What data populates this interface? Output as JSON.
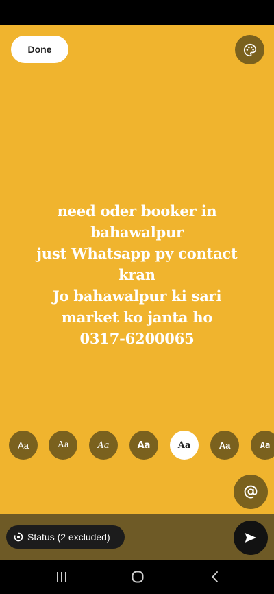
{
  "toolbar": {
    "done_label": "Done",
    "palette_icon": "palette-icon"
  },
  "status": {
    "text": "need oder booker in\nbahawalpur\njust Whatsapp py contact\nkran\nJo bahawalpur ki sari\nmarket ko janta ho\n0317-6200065",
    "background_color": "#F0B42E",
    "text_color": "#FFFFFF"
  },
  "font_options": {
    "items": [
      {
        "label": "Aa",
        "selected": false
      },
      {
        "label": "Aa",
        "selected": false
      },
      {
        "label": "Aa",
        "selected": false
      },
      {
        "label": "Aa",
        "selected": false
      },
      {
        "label": "Aa",
        "selected": true
      },
      {
        "label": "Aa",
        "selected": false
      },
      {
        "label": "Aa",
        "selected": false
      }
    ]
  },
  "mention": {
    "icon": "at-sign-icon"
  },
  "audience": {
    "label": "Status (2 excluded)",
    "icon": "status-ring-icon"
  },
  "send": {
    "icon": "send-icon"
  },
  "navigation": {
    "recents_icon": "recents-icon",
    "home_icon": "home-icon",
    "back_icon": "back-icon"
  },
  "colors": {
    "accent_dark": "#7A611E",
    "bottom_bar": "#6E5A26",
    "chip_bg": "#1C1C1C"
  }
}
